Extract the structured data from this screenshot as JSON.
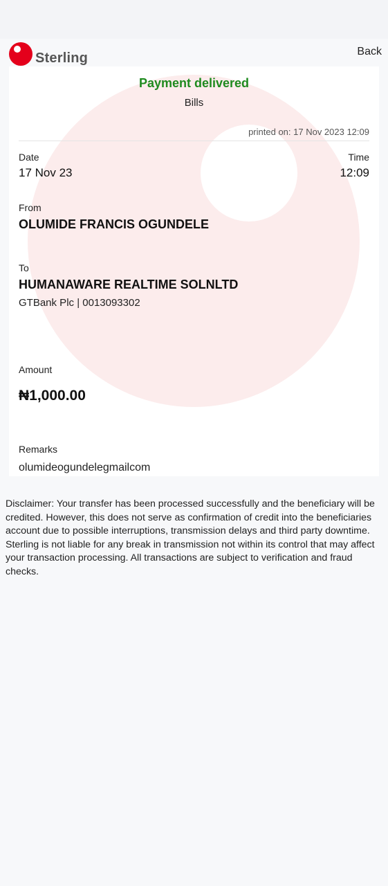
{
  "brand": {
    "name": "Sterling",
    "accent": "#e4001b",
    "logo_icon": "sterling-logo-icon"
  },
  "header": {
    "back_label": "Back"
  },
  "receipt": {
    "status": "Payment delivered",
    "status_color": "#1e8a1e",
    "category": "Bills",
    "printed_on": "printed on: 17 Nov 2023 12:09",
    "date_label": "Date",
    "date_value": "17 Nov 23",
    "time_label": "Time",
    "time_value": "12:09",
    "from_label": "From",
    "from_name": "OLUMIDE FRANCIS OGUNDELE",
    "to_label": "To",
    "to_name": "HUMANAWARE REALTIME SOLNLTD",
    "to_bank": "GTBank Plc | 0013093302",
    "amount_label": "Amount",
    "amount_value": "₦1,000.00",
    "remarks_label": "Remarks",
    "remarks_value": "olumideogundelegmailcom"
  },
  "disclaimer": "Disclaimer: Your transfer has been processed successfully and the beneficiary will be credited. However, this does not serve as confirmation of credit into the beneficiaries account due to possible interruptions, transmission delays and third party downtime. Sterling is not liable for any break in transmission not within its control that may affect your transaction processing. All transactions are subject to verification and fraud checks."
}
